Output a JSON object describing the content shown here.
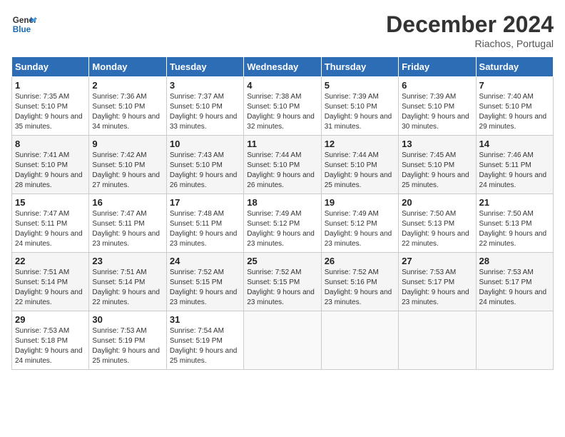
{
  "header": {
    "logo_line1": "General",
    "logo_line2": "Blue",
    "month_title": "December 2024",
    "location": "Riachos, Portugal"
  },
  "weekdays": [
    "Sunday",
    "Monday",
    "Tuesday",
    "Wednesday",
    "Thursday",
    "Friday",
    "Saturday"
  ],
  "weeks": [
    [
      {
        "day": "1",
        "sunrise": "Sunrise: 7:35 AM",
        "sunset": "Sunset: 5:10 PM",
        "daylight": "Daylight: 9 hours and 35 minutes."
      },
      {
        "day": "2",
        "sunrise": "Sunrise: 7:36 AM",
        "sunset": "Sunset: 5:10 PM",
        "daylight": "Daylight: 9 hours and 34 minutes."
      },
      {
        "day": "3",
        "sunrise": "Sunrise: 7:37 AM",
        "sunset": "Sunset: 5:10 PM",
        "daylight": "Daylight: 9 hours and 33 minutes."
      },
      {
        "day": "4",
        "sunrise": "Sunrise: 7:38 AM",
        "sunset": "Sunset: 5:10 PM",
        "daylight": "Daylight: 9 hours and 32 minutes."
      },
      {
        "day": "5",
        "sunrise": "Sunrise: 7:39 AM",
        "sunset": "Sunset: 5:10 PM",
        "daylight": "Daylight: 9 hours and 31 minutes."
      },
      {
        "day": "6",
        "sunrise": "Sunrise: 7:39 AM",
        "sunset": "Sunset: 5:10 PM",
        "daylight": "Daylight: 9 hours and 30 minutes."
      },
      {
        "day": "7",
        "sunrise": "Sunrise: 7:40 AM",
        "sunset": "Sunset: 5:10 PM",
        "daylight": "Daylight: 9 hours and 29 minutes."
      }
    ],
    [
      {
        "day": "8",
        "sunrise": "Sunrise: 7:41 AM",
        "sunset": "Sunset: 5:10 PM",
        "daylight": "Daylight: 9 hours and 28 minutes."
      },
      {
        "day": "9",
        "sunrise": "Sunrise: 7:42 AM",
        "sunset": "Sunset: 5:10 PM",
        "daylight": "Daylight: 9 hours and 27 minutes."
      },
      {
        "day": "10",
        "sunrise": "Sunrise: 7:43 AM",
        "sunset": "Sunset: 5:10 PM",
        "daylight": "Daylight: 9 hours and 26 minutes."
      },
      {
        "day": "11",
        "sunrise": "Sunrise: 7:44 AM",
        "sunset": "Sunset: 5:10 PM",
        "daylight": "Daylight: 9 hours and 26 minutes."
      },
      {
        "day": "12",
        "sunrise": "Sunrise: 7:44 AM",
        "sunset": "Sunset: 5:10 PM",
        "daylight": "Daylight: 9 hours and 25 minutes."
      },
      {
        "day": "13",
        "sunrise": "Sunrise: 7:45 AM",
        "sunset": "Sunset: 5:10 PM",
        "daylight": "Daylight: 9 hours and 25 minutes."
      },
      {
        "day": "14",
        "sunrise": "Sunrise: 7:46 AM",
        "sunset": "Sunset: 5:11 PM",
        "daylight": "Daylight: 9 hours and 24 minutes."
      }
    ],
    [
      {
        "day": "15",
        "sunrise": "Sunrise: 7:47 AM",
        "sunset": "Sunset: 5:11 PM",
        "daylight": "Daylight: 9 hours and 24 minutes."
      },
      {
        "day": "16",
        "sunrise": "Sunrise: 7:47 AM",
        "sunset": "Sunset: 5:11 PM",
        "daylight": "Daylight: 9 hours and 23 minutes."
      },
      {
        "day": "17",
        "sunrise": "Sunrise: 7:48 AM",
        "sunset": "Sunset: 5:11 PM",
        "daylight": "Daylight: 9 hours and 23 minutes."
      },
      {
        "day": "18",
        "sunrise": "Sunrise: 7:49 AM",
        "sunset": "Sunset: 5:12 PM",
        "daylight": "Daylight: 9 hours and 23 minutes."
      },
      {
        "day": "19",
        "sunrise": "Sunrise: 7:49 AM",
        "sunset": "Sunset: 5:12 PM",
        "daylight": "Daylight: 9 hours and 23 minutes."
      },
      {
        "day": "20",
        "sunrise": "Sunrise: 7:50 AM",
        "sunset": "Sunset: 5:13 PM",
        "daylight": "Daylight: 9 hours and 22 minutes."
      },
      {
        "day": "21",
        "sunrise": "Sunrise: 7:50 AM",
        "sunset": "Sunset: 5:13 PM",
        "daylight": "Daylight: 9 hours and 22 minutes."
      }
    ],
    [
      {
        "day": "22",
        "sunrise": "Sunrise: 7:51 AM",
        "sunset": "Sunset: 5:14 PM",
        "daylight": "Daylight: 9 hours and 22 minutes."
      },
      {
        "day": "23",
        "sunrise": "Sunrise: 7:51 AM",
        "sunset": "Sunset: 5:14 PM",
        "daylight": "Daylight: 9 hours and 22 minutes."
      },
      {
        "day": "24",
        "sunrise": "Sunrise: 7:52 AM",
        "sunset": "Sunset: 5:15 PM",
        "daylight": "Daylight: 9 hours and 23 minutes."
      },
      {
        "day": "25",
        "sunrise": "Sunrise: 7:52 AM",
        "sunset": "Sunset: 5:15 PM",
        "daylight": "Daylight: 9 hours and 23 minutes."
      },
      {
        "day": "26",
        "sunrise": "Sunrise: 7:52 AM",
        "sunset": "Sunset: 5:16 PM",
        "daylight": "Daylight: 9 hours and 23 minutes."
      },
      {
        "day": "27",
        "sunrise": "Sunrise: 7:53 AM",
        "sunset": "Sunset: 5:17 PM",
        "daylight": "Daylight: 9 hours and 23 minutes."
      },
      {
        "day": "28",
        "sunrise": "Sunrise: 7:53 AM",
        "sunset": "Sunset: 5:17 PM",
        "daylight": "Daylight: 9 hours and 24 minutes."
      }
    ],
    [
      {
        "day": "29",
        "sunrise": "Sunrise: 7:53 AM",
        "sunset": "Sunset: 5:18 PM",
        "daylight": "Daylight: 9 hours and 24 minutes."
      },
      {
        "day": "30",
        "sunrise": "Sunrise: 7:53 AM",
        "sunset": "Sunset: 5:19 PM",
        "daylight": "Daylight: 9 hours and 25 minutes."
      },
      {
        "day": "31",
        "sunrise": "Sunrise: 7:54 AM",
        "sunset": "Sunset: 5:19 PM",
        "daylight": "Daylight: 9 hours and 25 minutes."
      },
      null,
      null,
      null,
      null
    ]
  ]
}
